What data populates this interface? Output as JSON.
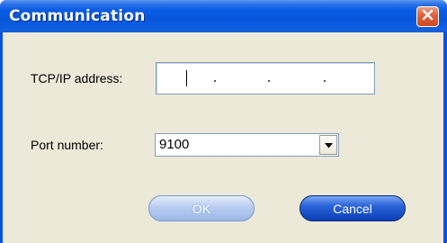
{
  "window": {
    "title": "Communication"
  },
  "close_icon": "close-icon",
  "form": {
    "ip_label": "TCP/IP address:",
    "ip_value": ".   .   .",
    "port_label": "Port number:",
    "port_value": "9100"
  },
  "buttons": {
    "ok_label": "OK",
    "cancel_label": "Cancel"
  },
  "colors": {
    "title_bar": "#0a5ee4",
    "close_button": "#e1633d",
    "dialog_bg": "#ece9d8",
    "cancel_button": "#2b63d9",
    "ok_button_disabled": "#b8cdf0"
  }
}
